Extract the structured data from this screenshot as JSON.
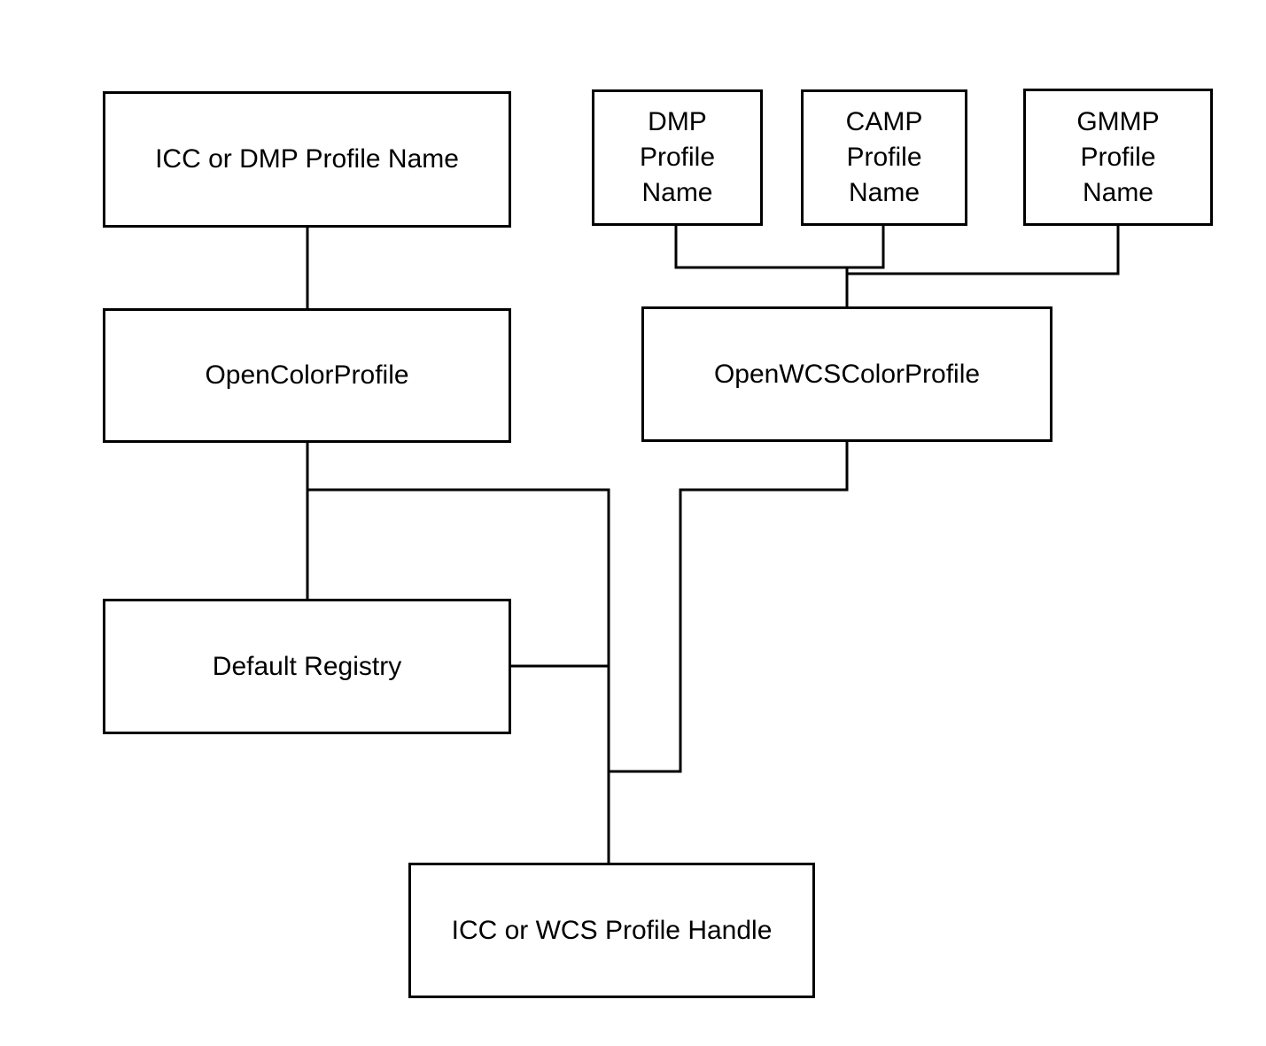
{
  "diagram": {
    "nodes": {
      "icc_dmp_profile_name": "ICC or DMP Profile Name",
      "dmp_profile_name": "DMP\nProfile\nName",
      "camp_profile_name": "CAMP\nProfile\nName",
      "gmmp_profile_name": "GMMP\nProfile\nName",
      "open_color_profile": "OpenColorProfile",
      "open_wcs_color_profile": "OpenWCSColorProfile",
      "default_registry": "Default Registry",
      "profile_handle": "ICC or WCS Profile Handle"
    },
    "edges": [
      {
        "from": "ICC or DMP Profile Name",
        "to": "OpenColorProfile"
      },
      {
        "from": "DMP Profile Name",
        "to": "OpenWCSColorProfile"
      },
      {
        "from": "CAMP Profile Name",
        "to": "OpenWCSColorProfile"
      },
      {
        "from": "GMMP Profile Name",
        "to": "OpenWCSColorProfile"
      },
      {
        "from": "OpenColorProfile",
        "to": "Default Registry"
      },
      {
        "from": "OpenColorProfile",
        "to": "ICC or WCS Profile Handle"
      },
      {
        "from": "Default Registry",
        "to": "ICC or WCS Profile Handle"
      },
      {
        "from": "OpenWCSColorProfile",
        "to": "ICC or WCS Profile Handle"
      }
    ]
  }
}
